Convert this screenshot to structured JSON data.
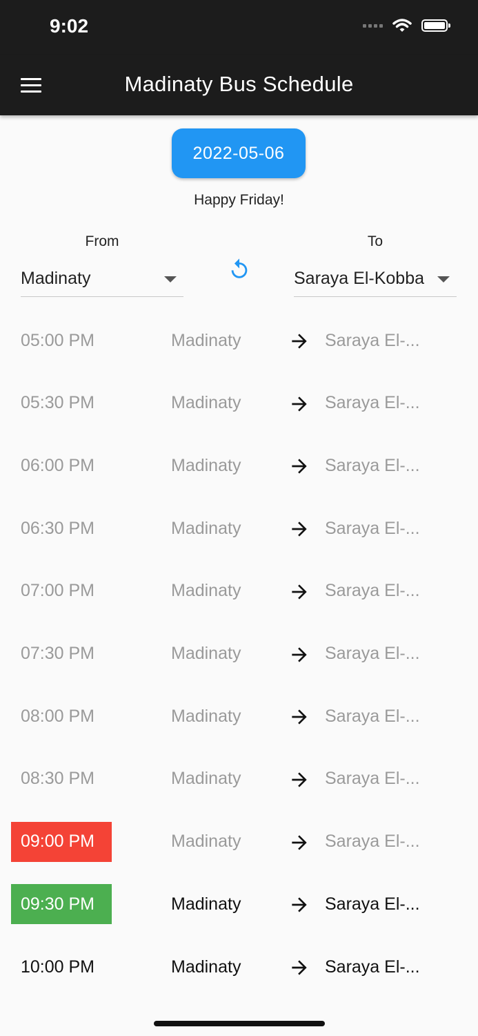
{
  "status_bar": {
    "time": "9:02"
  },
  "app_bar": {
    "title": "Madinaty Bus Schedule"
  },
  "date_button": {
    "label": "2022-05-06"
  },
  "greeting": "Happy Friday!",
  "from": {
    "label": "From",
    "value": "Madinaty"
  },
  "to": {
    "label": "To",
    "value": "Saraya El-Kobba"
  },
  "schedule": [
    {
      "time": "05:00 PM",
      "from": "Madinaty",
      "to": "Saraya El-...",
      "state": "past"
    },
    {
      "time": "05:30 PM",
      "from": "Madinaty",
      "to": "Saraya El-...",
      "state": "past"
    },
    {
      "time": "06:00 PM",
      "from": "Madinaty",
      "to": "Saraya El-...",
      "state": "past"
    },
    {
      "time": "06:30 PM",
      "from": "Madinaty",
      "to": "Saraya El-...",
      "state": "past"
    },
    {
      "time": "07:00 PM",
      "from": "Madinaty",
      "to": "Saraya El-...",
      "state": "past"
    },
    {
      "time": "07:30 PM",
      "from": "Madinaty",
      "to": "Saraya El-...",
      "state": "past"
    },
    {
      "time": "08:00 PM",
      "from": "Madinaty",
      "to": "Saraya El-...",
      "state": "past"
    },
    {
      "time": "08:30 PM",
      "from": "Madinaty",
      "to": "Saraya El-...",
      "state": "past"
    },
    {
      "time": "09:00 PM",
      "from": "Madinaty",
      "to": "Saraya El-...",
      "state": "missed"
    },
    {
      "time": "09:30 PM",
      "from": "Madinaty",
      "to": "Saraya El-...",
      "state": "next"
    },
    {
      "time": "10:00 PM",
      "from": "Madinaty",
      "to": "Saraya El-...",
      "state": "upcoming"
    }
  ],
  "colors": {
    "app_bar": "#1c1c1c",
    "accent": "#2196f3",
    "missed": "#f44336",
    "next": "#4caf50",
    "muted_text": "#9a9a9a"
  },
  "icons": {
    "menu": "menu-icon",
    "swap": "refresh-icon",
    "arrow": "arrow-right-icon"
  }
}
